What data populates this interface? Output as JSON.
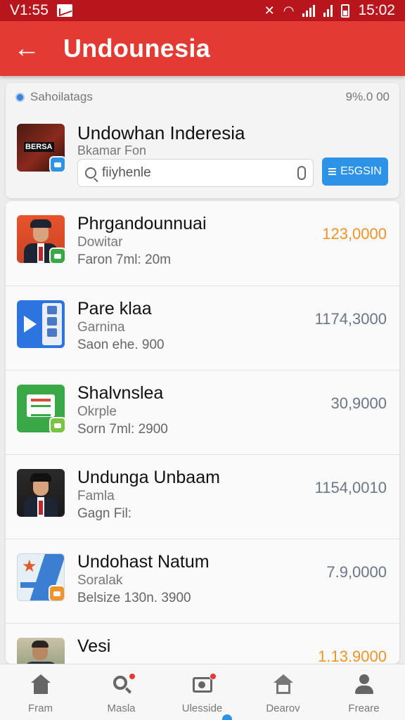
{
  "status_bar": {
    "left_text": "V1:55",
    "time": "15:02"
  },
  "app_bar": {
    "back_glyph": "←",
    "title": "Undounesia"
  },
  "header": {
    "tag": "Sahoilatags",
    "value": "9%.0 00",
    "thumb_logo": "BERSA",
    "title": "Undowhan Inderesia",
    "subtitle": "Bkamar Fon",
    "search_value": "fiiyhenle",
    "search_button": "E5GSIN"
  },
  "items": [
    {
      "name": "Phrgandounnuai",
      "sub": "Dowitar",
      "size": "Faron 7ml:  20m",
      "price": "123,0000",
      "price_color": "#f0932a"
    },
    {
      "name": "Pare klaa",
      "sub": "Garnina",
      "size": "Saon ehe. 900",
      "price": "1174,3000",
      "price_color": "#6b7786"
    },
    {
      "name": "Shalvnslea",
      "sub": "Okrple",
      "size": "Sorn 7ml:  2900",
      "price": "30,9000",
      "price_color": "#6b7786"
    },
    {
      "name": "Undunga Unbaam",
      "sub": "Famla",
      "size": "Gagn Fil:",
      "price": "1154,0010",
      "price_color": "#6b7786"
    },
    {
      "name": "Undohast Natum",
      "sub": "Soralak",
      "size": "Belsize 130n. 3900",
      "price": "7.9,0000",
      "price_color": "#6b7786"
    },
    {
      "name": "Vesi",
      "sub": "",
      "size": "",
      "price": "1.13.9000",
      "price_color": "#f0932a"
    }
  ],
  "nav": [
    {
      "label": "Fram",
      "icon": "home-icon"
    },
    {
      "label": "Masla",
      "icon": "search-icon"
    },
    {
      "label": "Ulesside",
      "icon": "media-icon"
    },
    {
      "label": "Dearov",
      "icon": "house-icon"
    },
    {
      "label": "Freare",
      "icon": "user-icon"
    }
  ],
  "colors": {
    "status_bar": "#b8161c",
    "app_bar": "#e33b33",
    "accent_blue": "#2d93e6",
    "price_orange": "#f0932a"
  }
}
